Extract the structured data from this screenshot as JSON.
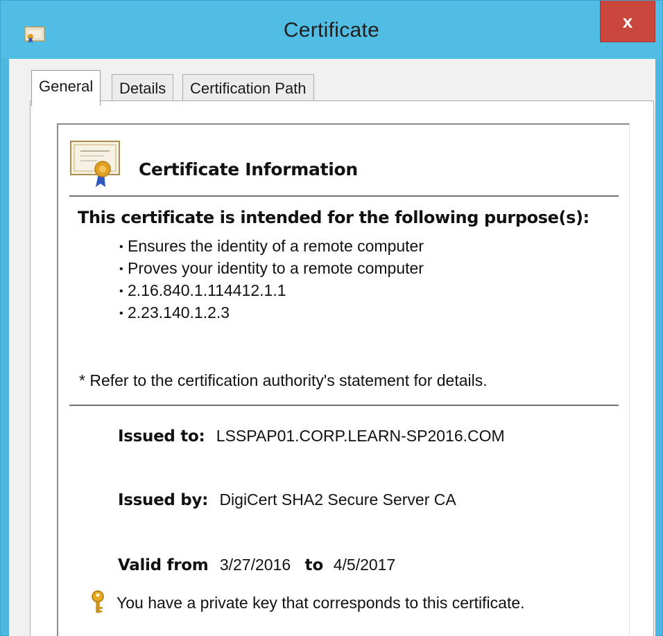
{
  "window": {
    "title": "Certificate",
    "close_label": "x"
  },
  "tabs": [
    {
      "label": "General",
      "active": true
    },
    {
      "label": "Details",
      "active": false
    },
    {
      "label": "Certification Path",
      "active": false
    }
  ],
  "general": {
    "info_title": "Certificate Information",
    "purpose_heading": "This certificate is intended for the following purpose(s):",
    "purposes": [
      "Ensures the identity of a remote computer",
      "Proves your identity to a remote computer",
      "2.16.840.1.114412.1.1",
      "2.23.140.1.2.3"
    ],
    "refer_note": "* Refer to the certification authority's statement for details.",
    "issued_to_label": "Issued to:",
    "issued_to": "LSSPAP01.CORP.LEARN-SP2016.COM",
    "issued_by_label": "Issued by:",
    "issued_by": "DigiCert SHA2 Secure Server CA",
    "valid_from_label": "Valid from",
    "valid_from": "3/27/2016",
    "valid_to_label": "to",
    "valid_to": "4/5/2017",
    "private_key_note": "You have a private key that corresponds to this certificate."
  },
  "icons": {
    "title": "certificate-icon",
    "info": "certificate-ribbon-icon",
    "key": "key-icon",
    "close": "close-icon"
  },
  "colors": {
    "titlebar": "#52bde4",
    "close_button": "#c8463b"
  }
}
